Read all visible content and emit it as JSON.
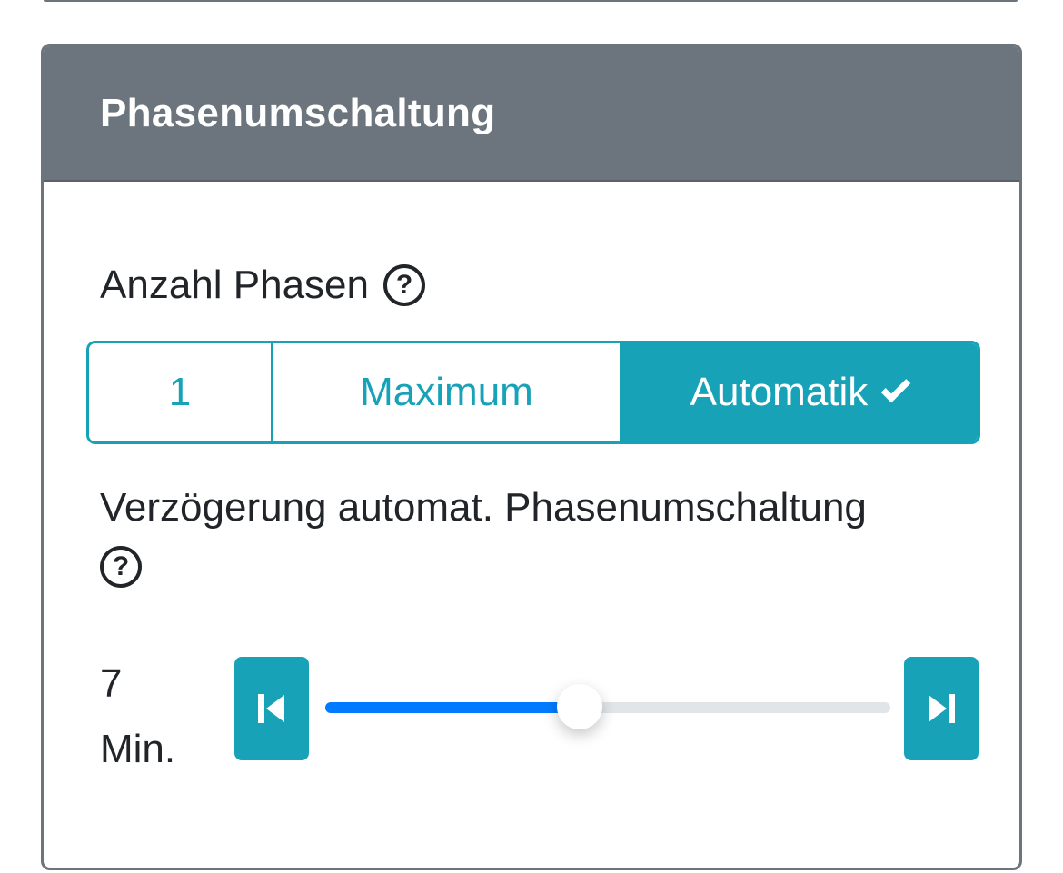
{
  "panel": {
    "title": "Phasenumschaltung",
    "phases": {
      "label": "Anzahl Phasen",
      "help_glyph": "?",
      "options": [
        "1",
        "Maximum",
        "Automatik"
      ],
      "selected": "Automatik"
    },
    "delay": {
      "label": "Verzögerung automat. Phasenumschaltung",
      "help_glyph": "?",
      "value": "7",
      "unit": "Min.",
      "slider_fraction": 0.45,
      "decrement_icon": "skip-start-icon",
      "increment_icon": "skip-end-icon"
    }
  },
  "colors": {
    "header": "#6c757d",
    "accent": "#17a2b8",
    "slider_fill": "#007bff"
  }
}
